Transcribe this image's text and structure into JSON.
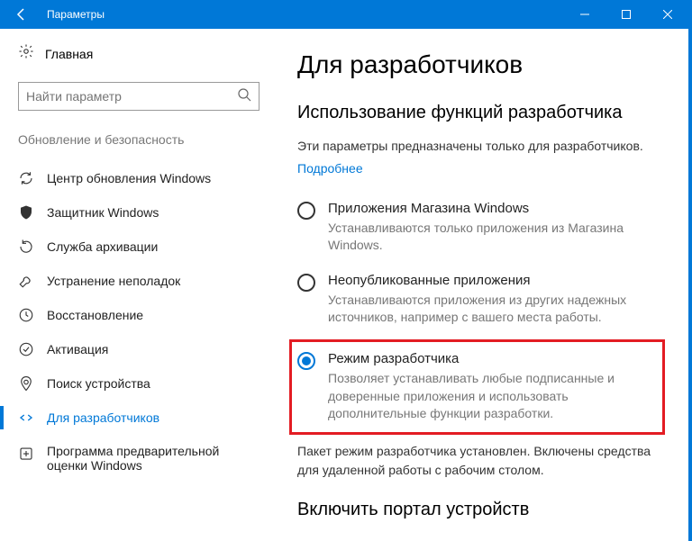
{
  "titlebar": {
    "title": "Параметры"
  },
  "sidebar": {
    "home": "Главная",
    "search_placeholder": "Найти параметр",
    "section": "Обновление и безопасность",
    "items": [
      {
        "label": "Центр обновления Windows"
      },
      {
        "label": "Защитник Windows"
      },
      {
        "label": "Служба архивации"
      },
      {
        "label": "Устранение неполадок"
      },
      {
        "label": "Восстановление"
      },
      {
        "label": "Активация"
      },
      {
        "label": "Поиск устройства"
      },
      {
        "label": "Для разработчиков"
      },
      {
        "label": "Программа предварительной оценки Windows"
      }
    ]
  },
  "main": {
    "heading": "Для разработчиков",
    "subheading": "Использование функций разработчика",
    "intro": "Эти параметры предназначены только для разработчиков.",
    "learn_more": "Подробнее",
    "options": [
      {
        "title": "Приложения Магазина Windows",
        "desc": "Устанавливаются только приложения из Магазина Windows."
      },
      {
        "title": "Неопубликованные приложения",
        "desc": "Устанавливаются приложения из других надежных источников, например с вашего места работы."
      },
      {
        "title": "Режим разработчика",
        "desc": "Позволяет устанавливать любые подписанные и доверенные приложения и использовать дополнительные функции разработки."
      }
    ],
    "status": "Пакет режим разработчика установлен. Включены средства для удаленной работы с рабочим столом.",
    "portal_heading": "Включить портал устройств"
  }
}
